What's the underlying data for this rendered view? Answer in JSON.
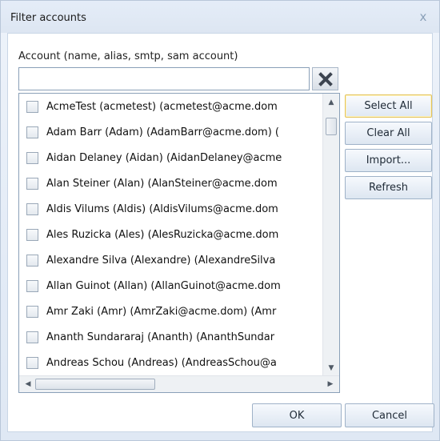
{
  "window": {
    "title": "Filter accounts",
    "close_glyph": "x"
  },
  "search": {
    "label": "Account (name, alias, smtp, sam account)",
    "value": "",
    "placeholder": ""
  },
  "accounts": [
    "AcmeTest  (acmetest) (acmetest@acme.dom",
    "Adam Barr (Adam) (AdamBarr@acme.dom) (",
    "Aidan Delaney (Aidan) (AidanDelaney@acme",
    "Alan Steiner (Alan) (AlanSteiner@acme.dom",
    "Aldis Vilums (Aldis) (AldisVilums@acme.dom",
    "Ales Ruzicka (Ales) (AlesRuzicka@acme.dom",
    "Alexandre Silva (Alexandre) (AlexandreSilva",
    "Allan Guinot (Allan) (AllanGuinot@acme.dom",
    "Amr Zaki (Amr) (AmrZaki@acme.dom) (Amr",
    "Ananth Sundararaj (Ananth) (AnanthSundar",
    "Andreas Schou (Andreas) (AndreasSchou@a"
  ],
  "side_buttons": {
    "select_all": "Select All",
    "clear_all": "Clear All",
    "import": "Import...",
    "refresh": "Refresh"
  },
  "footer": {
    "ok": "OK",
    "cancel": "Cancel"
  },
  "icons": {
    "clear_search": "clear-x-icon",
    "close": "close-icon",
    "checkbox": "checkbox-icon"
  },
  "colors": {
    "focus_border": "#e3c35c",
    "button_border": "#9fb2c8",
    "dialog_background": "#e3ebf6"
  }
}
